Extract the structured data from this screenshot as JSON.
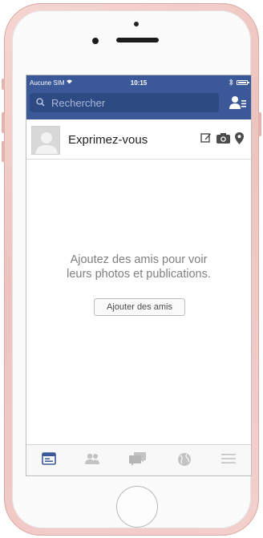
{
  "status_bar": {
    "carrier": "Aucune SIM",
    "time": "10:15"
  },
  "header": {
    "search_placeholder": "Rechercher",
    "friend_requests_icon": "friend-requests-icon"
  },
  "composer": {
    "prompt": "Exprimez-vous",
    "icons": [
      "edit-icon",
      "camera-icon",
      "location-pin-icon"
    ]
  },
  "empty_state": {
    "line1": "Ajoutez des amis pour voir",
    "line2": "leurs photos et publications.",
    "button_label": "Ajouter des amis"
  },
  "tabs": [
    {
      "icon": "news-feed-icon",
      "active": true
    },
    {
      "icon": "friends-icon",
      "active": false
    },
    {
      "icon": "messages-icon",
      "active": false
    },
    {
      "icon": "notifications-globe-icon",
      "active": false
    },
    {
      "icon": "menu-icon",
      "active": false
    }
  ],
  "colors": {
    "header_blue": "#3b5998",
    "search_field": "#2e4a83",
    "active_tab": "#3b5998",
    "inactive_tab": "#c3c3c3",
    "phone_frame": "#f3d0cc"
  }
}
